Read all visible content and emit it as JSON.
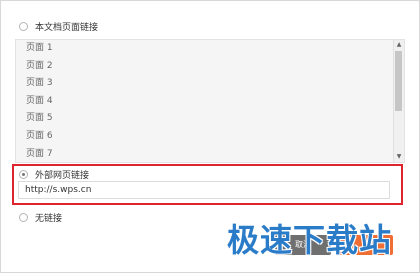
{
  "options": {
    "doc_link": {
      "label": "本文档页面链接",
      "selected": false
    },
    "external_link": {
      "label": "外部网页链接",
      "selected": true
    },
    "no_link": {
      "label": "无链接",
      "selected": false
    }
  },
  "page_list": {
    "items": [
      "页面 1",
      "页面 2",
      "页面 3",
      "页面 4",
      "页面 5",
      "页面 6",
      "页面 7"
    ]
  },
  "url_input": {
    "value": "http://s.wps.cn"
  },
  "buttons": {
    "cancel_label": "取消"
  },
  "watermark": {
    "text": "极速下载站"
  },
  "colors": {
    "highlight_border": "#e0242f",
    "confirm_button": "#f06d33",
    "cancel_button": "#6f6f6f",
    "watermark": "#2b7cc8"
  }
}
